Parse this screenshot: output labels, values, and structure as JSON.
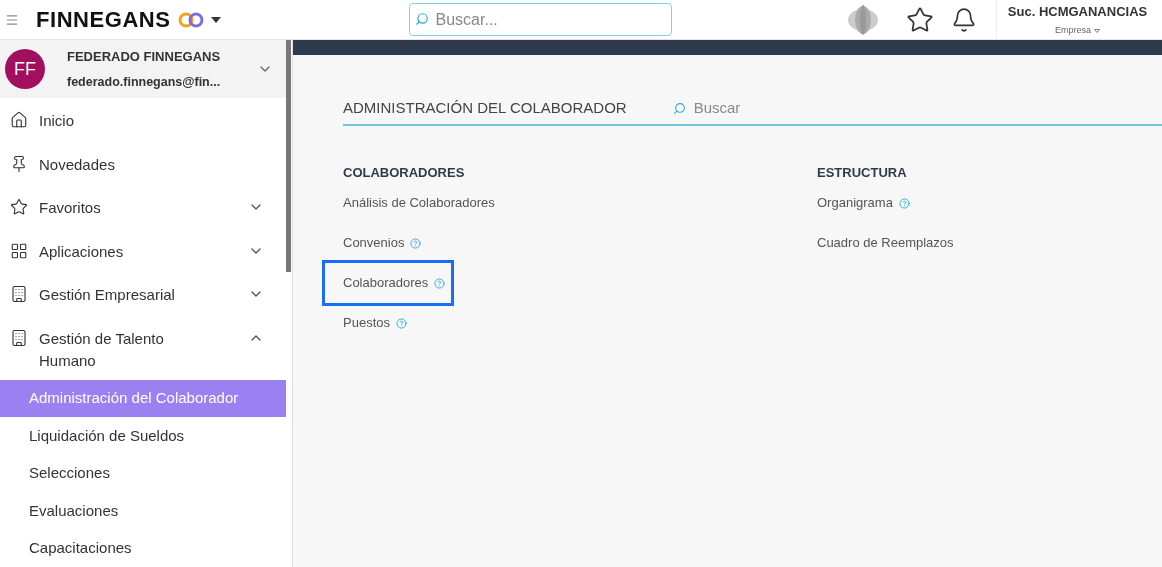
{
  "header": {
    "brand": "FINNEGANS",
    "search": {
      "placeholder": "Buscar..."
    },
    "branch": "Suc. HCMGANANCIAS",
    "company": "Empresa"
  },
  "user": {
    "initials": "FF",
    "name": "FEDERADO FINNEGANS",
    "email": "federado.finnegans@fin..."
  },
  "sidebar": {
    "items": [
      {
        "label": "Inicio",
        "kind": "home"
      },
      {
        "label": "Novedades",
        "kind": "pin"
      },
      {
        "label": "Favoritos",
        "kind": "star",
        "expanded": false
      },
      {
        "label": "Aplicaciones",
        "kind": "grid",
        "expanded": false
      },
      {
        "label": "Gestión Empresarial",
        "kind": "building",
        "expanded": false
      },
      {
        "label": "Gestión de Talento Humano",
        "kind": "building",
        "expanded": true,
        "children": [
          {
            "label": "Administración del Colaborador",
            "selected": true
          },
          {
            "label": "Liquidación de Sueldos",
            "selected": false
          },
          {
            "label": "Selecciones",
            "selected": false
          },
          {
            "label": "Evaluaciones",
            "selected": false
          },
          {
            "label": "Capacitaciones",
            "selected": false
          }
        ]
      }
    ]
  },
  "main": {
    "title": "ADMINISTRACIÓN DEL COLABORADOR",
    "search": {
      "placeholder": "Buscar"
    },
    "sections": [
      {
        "heading": "COLABORADORES",
        "links": [
          {
            "label": "Análisis de Colaboradores",
            "help": false,
            "highlighted": false
          },
          {
            "label": "Convenios",
            "help": true,
            "highlighted": false
          },
          {
            "label": "Colaboradores",
            "help": true,
            "highlighted": true
          },
          {
            "label": "Puestos",
            "help": true,
            "highlighted": false
          }
        ]
      },
      {
        "heading": "ESTRUCTURA",
        "links": [
          {
            "label": "Organigrama",
            "help": true,
            "highlighted": false
          },
          {
            "label": "Cuadro de Reemplazos",
            "help": false,
            "highlighted": false
          }
        ]
      }
    ]
  }
}
